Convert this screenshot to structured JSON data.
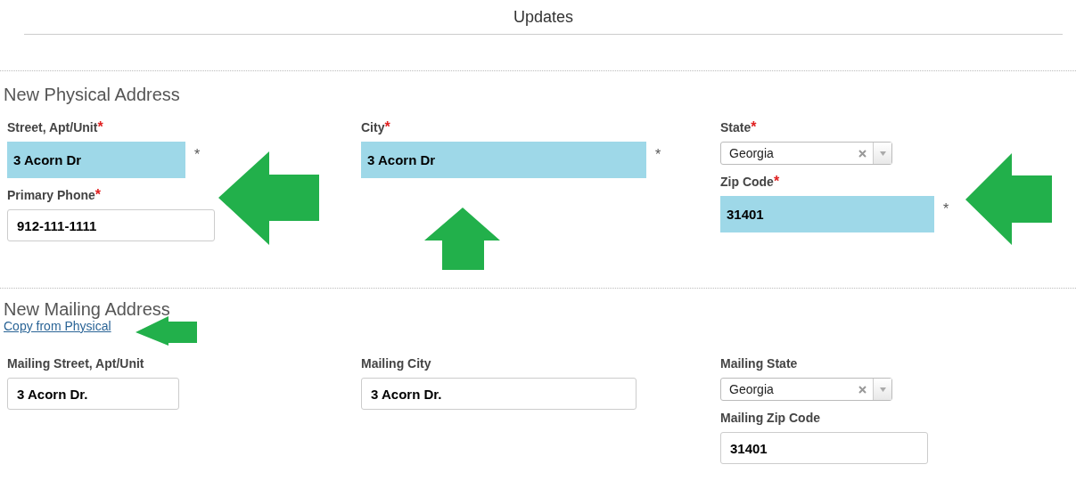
{
  "title": "Updates",
  "sections": [
    {
      "heading": "New Physical Address",
      "columns": [
        [
          {
            "kind": "text",
            "label": "Street, Apt/Unit",
            "required_mark": "*",
            "value": "3 Acorn Dr",
            "highlighted": true,
            "suffix": "*"
          },
          {
            "kind": "text",
            "label": "Primary Phone",
            "required_mark": "*",
            "value": "912-111-1111",
            "highlighted": false
          }
        ],
        [
          {
            "kind": "text",
            "label": "City",
            "required_mark": "*",
            "value": "3 Acorn Dr",
            "highlighted": true,
            "suffix": "*"
          }
        ],
        [
          {
            "kind": "select",
            "label": "State",
            "required_mark": "*",
            "value": "Georgia"
          },
          {
            "kind": "text",
            "label": "Zip Code",
            "required_mark": "*",
            "value": "31401",
            "highlighted": true,
            "suffix": "*"
          }
        ]
      ]
    },
    {
      "heading": "New Mailing Address",
      "link": "Copy from Physical",
      "columns": [
        [
          {
            "kind": "text",
            "label": "Mailing Street, Apt/Unit",
            "value": "3 Acorn Dr.",
            "highlighted": false
          }
        ],
        [
          {
            "kind": "text",
            "label": "Mailing City",
            "value": "3 Acorn Dr.",
            "highlighted": false
          }
        ],
        [
          {
            "kind": "select",
            "label": "Mailing State",
            "value": "Georgia"
          },
          {
            "kind": "text",
            "label": "Mailing Zip Code",
            "value": "31401",
            "highlighted": false
          }
        ]
      ]
    }
  ]
}
